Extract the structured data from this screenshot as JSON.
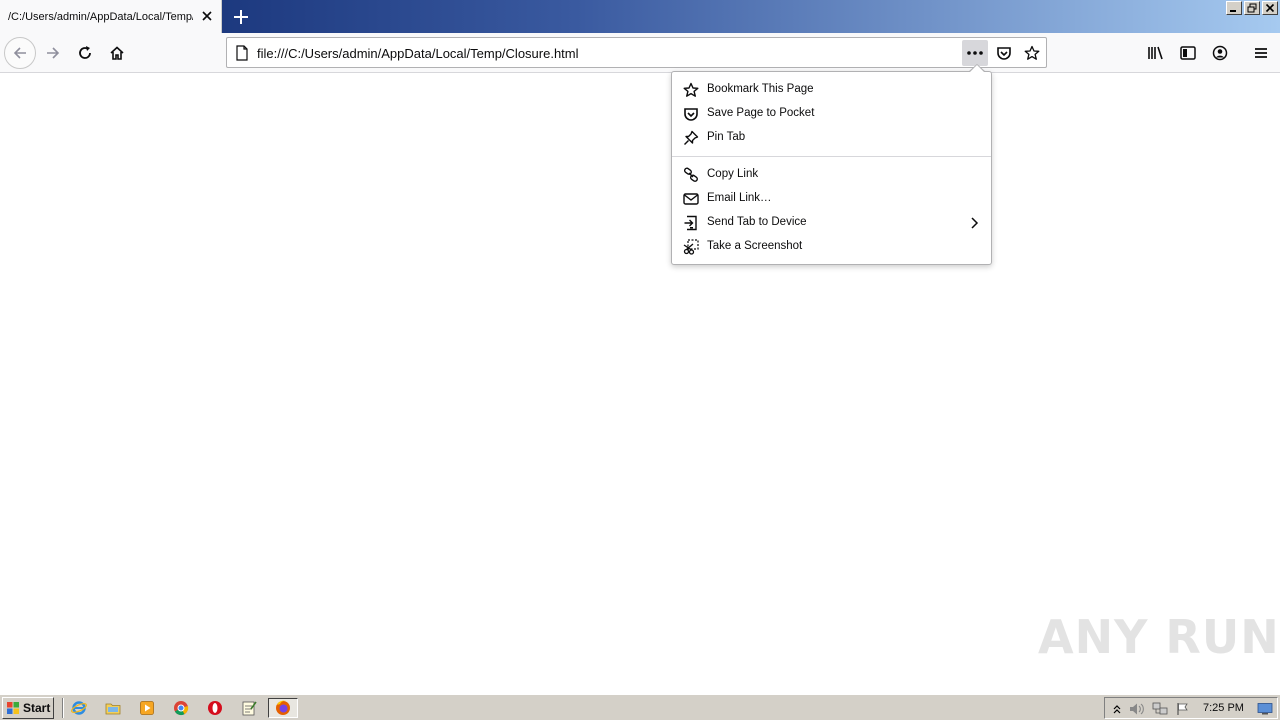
{
  "browser": {
    "tab": {
      "title": "/C:/Users/admin/AppData/Local/Temp/Closure.html"
    },
    "url": "file:///C:/Users/admin/AppData/Local/Temp/Closure.html"
  },
  "page_action_menu": {
    "items": [
      {
        "label": "Bookmark This Page",
        "icon": "star-icon"
      },
      {
        "label": "Save Page to Pocket",
        "icon": "pocket-icon"
      },
      {
        "label": "Pin Tab",
        "icon": "pin-icon"
      },
      {
        "label": "Copy Link",
        "icon": "link-icon"
      },
      {
        "label": "Email Link…",
        "icon": "mail-icon"
      },
      {
        "label": "Send Tab to Device",
        "icon": "send-tab-icon",
        "has_submenu": true
      },
      {
        "label": "Take a Screenshot",
        "icon": "screenshot-icon"
      }
    ]
  },
  "watermark": "ANY RUN",
  "taskbar": {
    "start_label": "Start",
    "clock": "7:25 PM"
  },
  "colors": {
    "titlebar_start": "#0a246a",
    "toolbar_bg": "#f9f9fa",
    "taskbar_bg": "#d4d0c8",
    "menu_border": "#b1b1b3"
  }
}
